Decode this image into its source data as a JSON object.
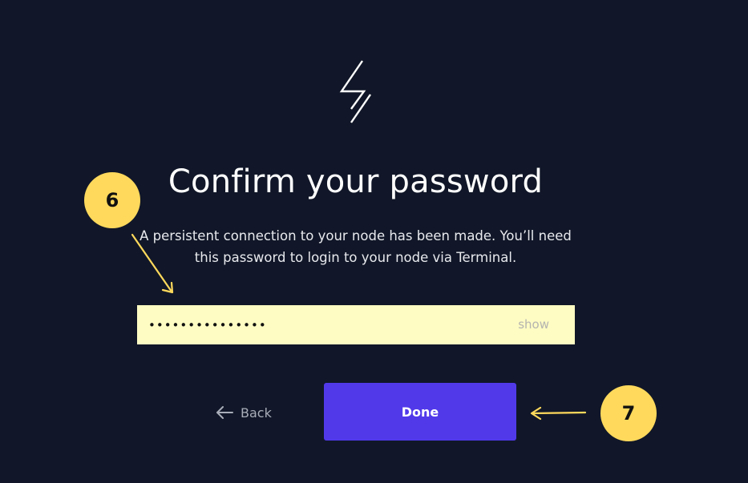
{
  "logo": {
    "icon": "lightning-bolt-icon"
  },
  "page": {
    "title": "Confirm your password",
    "subtitle": "A persistent connection to your node has been made. You’ll need this password to login to your node via Terminal."
  },
  "password_field": {
    "value": "•••••••••••••••",
    "toggle_label": "show"
  },
  "actions": {
    "back_label": "Back",
    "done_label": "Done"
  },
  "annotations": {
    "step_6": "6",
    "step_7": "7"
  },
  "colors": {
    "background": "#111728",
    "input_background": "#fefcc3",
    "primary_button": "#5139ea",
    "annotation_yellow": "#ffd95c"
  }
}
